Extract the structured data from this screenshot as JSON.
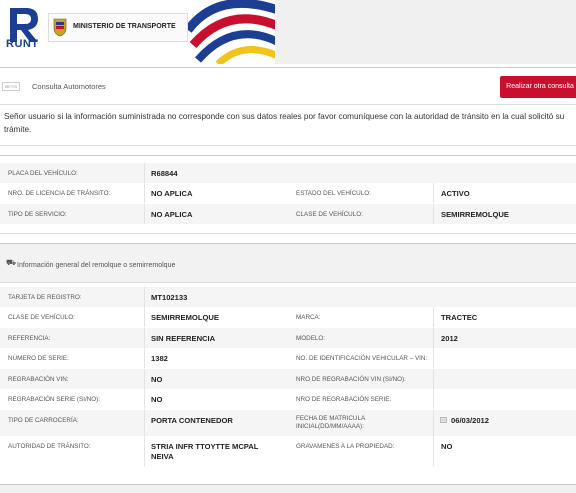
{
  "header": {
    "logo_text": "RUNT",
    "ministry": "MINISTERIO DE TRANSPORTE"
  },
  "bar": {
    "icon_text": "METIS",
    "title": "Consulta Automotores",
    "button_label": "Realizar otra consulta"
  },
  "notice": "Señor usuario si la información suministrada no corresponde con sus datos reales por favor comuníquese con la autoridad de tránsito en la cual solicitó su trámite.",
  "vehicle": {
    "placa_label": "PLACA DEL VEHÍCULO:",
    "placa_value": "R68844",
    "licencia_label": "NRO. DE LICENCIA DE TRÁNSITO:",
    "licencia_value": "NO APLICA",
    "estado_label": "ESTADO DEL VEHÍCULO:",
    "estado_value": "ACTIVO",
    "servicio_label": "TIPO DE SERVICIO:",
    "servicio_value": "NO APLICA",
    "clase_label": "CLASE DE VEHÍCULO:",
    "clase_value": "SEMIRREMOLQUE"
  },
  "trailer": {
    "section_title": "Información general del remolque o semirremolque",
    "tarjeta_label": "TARJETA DE REGISTRO:",
    "tarjeta_value": "MT102133",
    "clase_label": "CLASE DE VEHÍCULO:",
    "clase_value": "SEMIRREMOLQUE",
    "marca_label": "MARCA:",
    "marca_value": "TRACTEC",
    "referencia_label": "REFERENCIA:",
    "referencia_value": "SIN REFERENCIA",
    "modelo_label": "MODELO:",
    "modelo_value": "2012",
    "serie_label": "NÚMERO DE SERIE:",
    "serie_value": "1382",
    "vin_id_label": "NO. DE IDENTIFICACIÓN VEHICULAR – VIN:",
    "vin_id_value": "",
    "regrab_vin_label": "REGRABACIÓN VIN:",
    "regrab_vin_value": "NO",
    "nro_regrab_vin_label": "NRO DE REGRABACIÓN VIN (SI/NO):",
    "nro_regrab_vin_value": "",
    "regrab_serie_label": "REGRABACIÓN SERIE (SI/NO):",
    "regrab_serie_value": "NO",
    "nro_regrab_serie_label": "NRO DE REGRABACIÓN SERIE:",
    "nro_regrab_serie_value": "",
    "carroceria_label": "TIPO DE CARROCERÍA:",
    "carroceria_value": "PORTA CONTENEDOR",
    "fecha_label": "FECHA DE MATRICULA INICIAL(DD/MM/AAAA):",
    "fecha_value": "06/03/2012",
    "autoridad_label": "AUTORIDAD DE TRÁNSITO:",
    "autoridad_value": "STRIA INFR TTOyTTE MCPAL NEIVA",
    "gravamenes_label": "GRAVAMENES A LA PROPIEDAD:",
    "gravamenes_value": "NO"
  }
}
